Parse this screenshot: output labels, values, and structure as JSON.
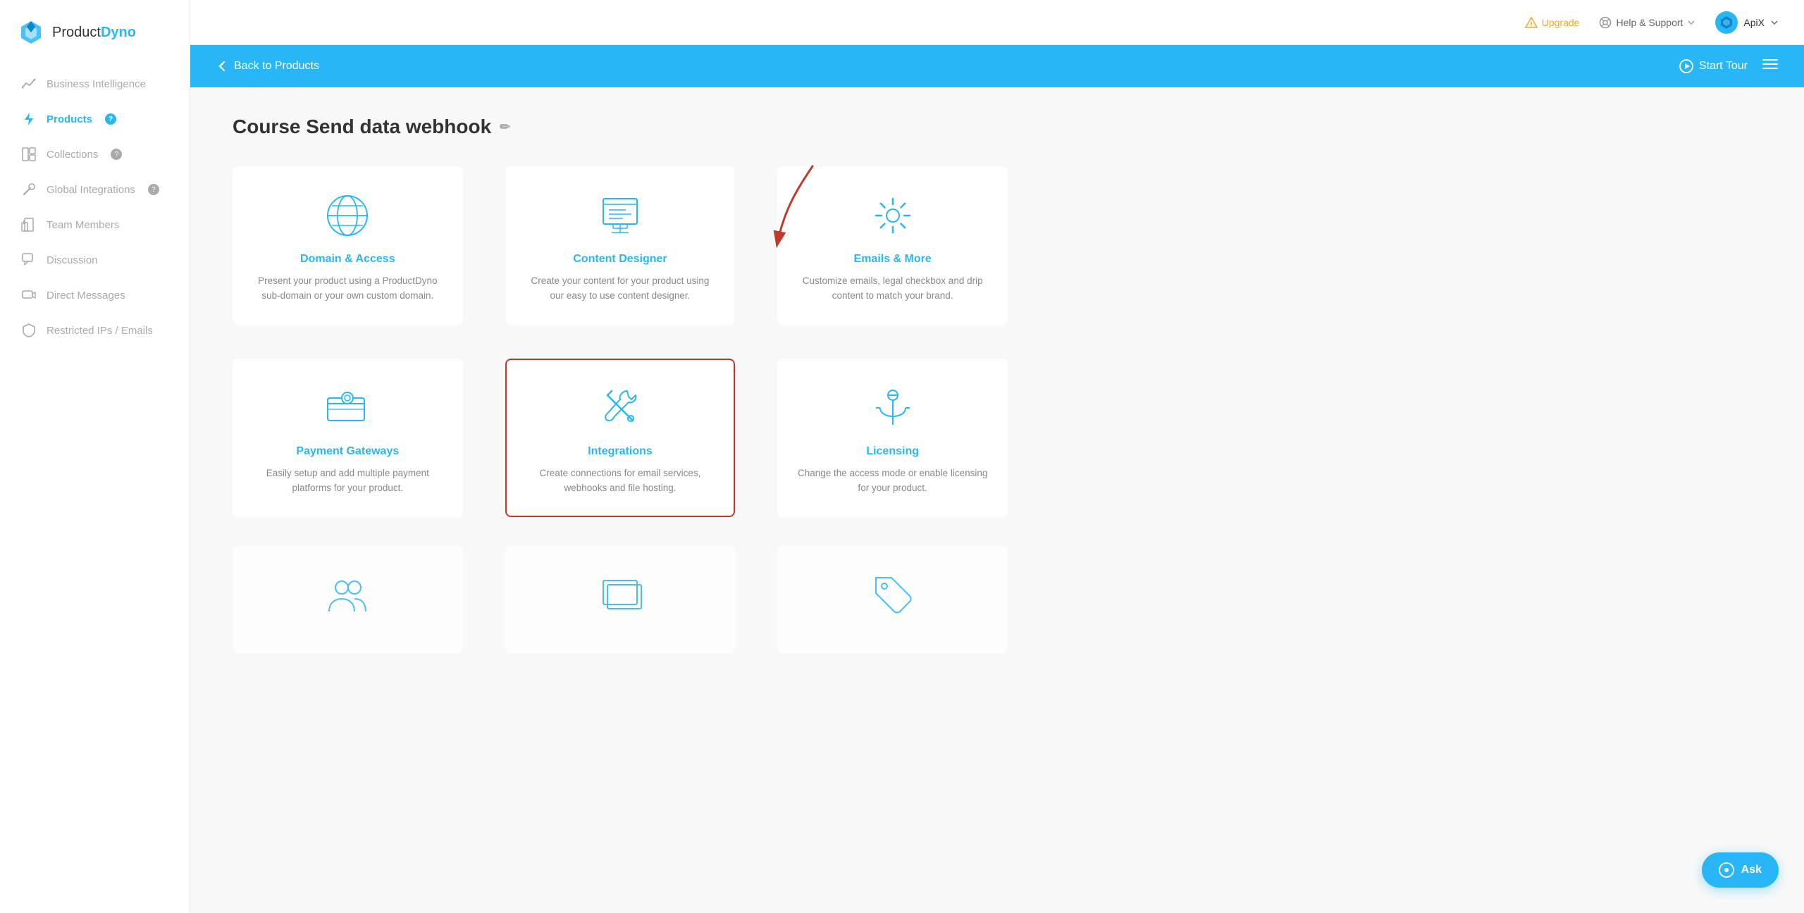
{
  "app": {
    "logo_text_1": "Product",
    "logo_text_2": "Dyno"
  },
  "sidebar": {
    "items": [
      {
        "id": "business-intelligence",
        "label": "Business Intelligence",
        "icon": "chart",
        "active": false,
        "help": false
      },
      {
        "id": "products",
        "label": "Products",
        "icon": "bolt",
        "active": true,
        "help": true
      },
      {
        "id": "collections",
        "label": "Collections",
        "icon": "layout",
        "active": false,
        "help": true
      },
      {
        "id": "global-integrations",
        "label": "Global Integrations",
        "icon": "wrench",
        "active": false,
        "help": true
      },
      {
        "id": "team-members",
        "label": "Team Members",
        "icon": "team",
        "active": false,
        "help": false
      },
      {
        "id": "discussion",
        "label": "Discussion",
        "icon": "chat",
        "active": false,
        "help": false
      },
      {
        "id": "direct-messages",
        "label": "Direct Messages",
        "icon": "message",
        "active": false,
        "help": false
      },
      {
        "id": "restricted-ips",
        "label": "Restricted IPs / Emails",
        "icon": "shield",
        "active": false,
        "help": false
      }
    ]
  },
  "header": {
    "upgrade_label": "Upgrade",
    "help_label": "Help & Support",
    "user_label": "ApiX"
  },
  "blue_bar": {
    "back_label": "Back to Products",
    "start_tour_label": "Start Tour"
  },
  "page": {
    "title": "Course Send data webhook",
    "edit_icon": "✏"
  },
  "cards": [
    {
      "id": "domain-access",
      "title": "Domain & Access",
      "desc": "Present your product using a ProductDyno sub-domain or your own custom domain.",
      "highlighted": false
    },
    {
      "id": "content-designer",
      "title": "Content Designer",
      "desc": "Create your content for your product using our easy to use content designer.",
      "highlighted": false
    },
    {
      "id": "emails-more",
      "title": "Emails & More",
      "desc": "Customize emails, legal checkbox and drip content to match your brand.",
      "highlighted": false
    },
    {
      "id": "payment-gateways",
      "title": "Payment Gateways",
      "desc": "Easily setup and add multiple payment platforms for your product.",
      "highlighted": false
    },
    {
      "id": "integrations",
      "title": "Integrations",
      "desc": "Create connections for email services, webhooks and file hosting.",
      "highlighted": true
    },
    {
      "id": "licensing",
      "title": "Licensing",
      "desc": "Change the access mode or enable licensing for your product.",
      "highlighted": false
    }
  ],
  "ask_button": {
    "label": "Ask"
  }
}
